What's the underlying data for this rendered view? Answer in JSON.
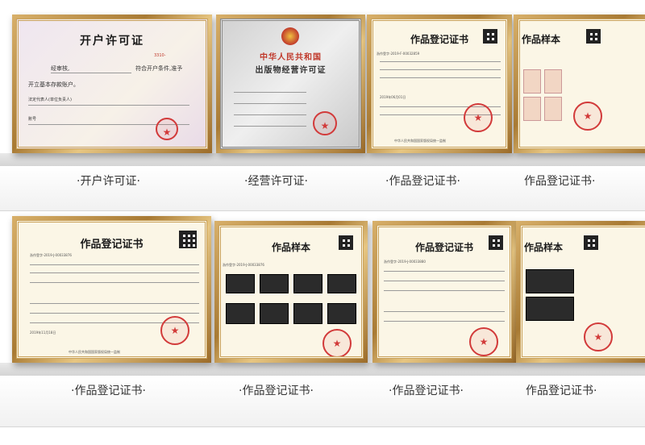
{
  "row1": {
    "certs": [
      {
        "title": "开户许可证",
        "label": "·开户许可证·",
        "lines": [
          "经审核,",
          "符合开户条件,准予",
          "开立基本存款账户。",
          "法定代表人(单位负责人)",
          "账号"
        ],
        "number": "3310-"
      },
      {
        "title": "中华人民共和国",
        "subtitle": "出版物经营许可证",
        "label": "·经营许可证·"
      },
      {
        "title": "作品登记证书",
        "label": "·作品登记证书·",
        "reg_no": "浙作登字-2019-F-00032859",
        "date": "2019年06月01日",
        "footer": "中华人民共和国国家版权局统一监制"
      },
      {
        "title": "作品样本",
        "label": "作品登记证书·"
      }
    ]
  },
  "row2": {
    "certs": [
      {
        "title": "作品登记证书",
        "label": "·作品登记证书·",
        "reg_no": "浙作登字-2019-J-00033876",
        "date": "2019年11月18日",
        "footer": "中华人民共和国国家版权局统一监制"
      },
      {
        "title": "作品样本",
        "label": "·作品登记证书·",
        "reg_no": "浙作登字-2019-J-00033876"
      },
      {
        "title": "作品登记证书",
        "label": "·作品登记证书·",
        "reg_no": "浙作登字-2019-J-00033880"
      },
      {
        "title": "作品样本",
        "label": "作品登记证书·"
      }
    ]
  },
  "colors": {
    "frame_gold": "#b98a3e",
    "paper": "#fbf6e6",
    "seal_red": "#d23a3a",
    "label_text": "#333333"
  }
}
